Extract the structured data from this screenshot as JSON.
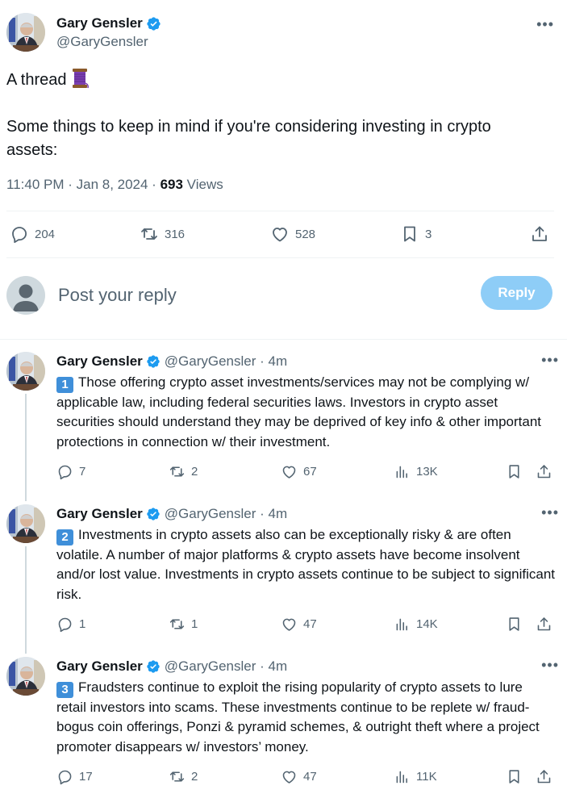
{
  "main_tweet": {
    "author_name": "Gary Gensler",
    "handle": "@GaryGensler",
    "text_line1": "A thread",
    "text_body": "Some things to keep in mind if you're considering investing in crypto assets:",
    "timestamp": "11:40 PM · Jan 8, 2024 · ",
    "views_count": "693",
    "views_label": " Views",
    "replies": "204",
    "reposts": "316",
    "likes": "528",
    "bookmarks": "3"
  },
  "composer": {
    "placeholder": "Post your reply",
    "button_label": "Reply"
  },
  "thread": [
    {
      "author_name": "Gary Gensler",
      "handle_time": "@GaryGensler · 4m",
      "number": "1",
      "text": "Those offering crypto asset investments/services may not be complying w/ applicable law, including federal securities laws. Investors in crypto asset securities should understand they may be deprived of key info & other important protections in connection w/ their investment.",
      "replies": "7",
      "reposts": "2",
      "likes": "67",
      "views": "13K"
    },
    {
      "author_name": "Gary Gensler",
      "handle_time": "@GaryGensler · 4m",
      "number": "2",
      "text": "Investments in crypto assets also can be exceptionally risky & are often volatile. A number of major platforms & crypto assets have become insolvent and/or lost value. Investments in crypto assets continue to be subject to significant risk.",
      "replies": "1",
      "reposts": "1",
      "likes": "47",
      "views": "14K"
    },
    {
      "author_name": "Gary Gensler",
      "handle_time": "@GaryGensler · 4m",
      "number": "3",
      "text": "Fraudsters continue to exploit the rising popularity of crypto assets to lure retail investors into scams. These investments continue to be replete w/ fraud- bogus coin offerings, Ponzi & pyramid schemes, & outright theft where a project promoter disappears w/ investors’ money.",
      "replies": "17",
      "reposts": "2",
      "likes": "47",
      "views": "11K"
    }
  ],
  "icons": {
    "verified": "verified-badge-icon",
    "spool": "thread-spool-emoji",
    "reply": "reply-icon",
    "repost": "repost-icon",
    "like": "heart-icon",
    "bookmark": "bookmark-icon",
    "share": "share-icon",
    "views": "views-chart-icon",
    "more": "more-icon"
  },
  "colors": {
    "text": "#0f1419",
    "secondary": "#536471",
    "reply_button": "#8ecdf7",
    "verified": "#1d9bf0",
    "number_key": "#3f8fd9"
  }
}
